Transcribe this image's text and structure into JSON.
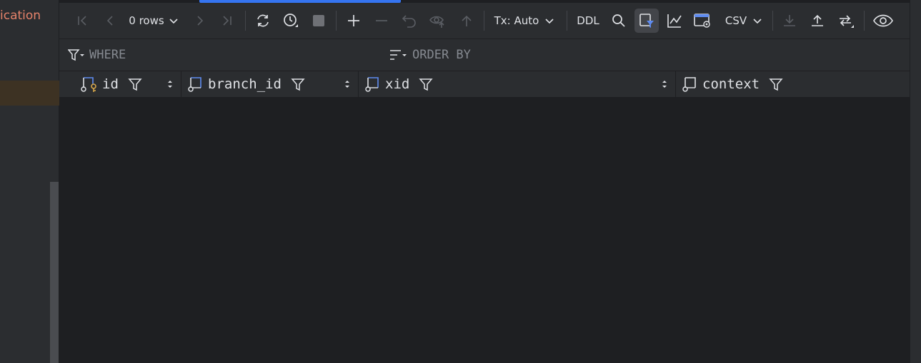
{
  "sidebar": {
    "truncated_label": "ication"
  },
  "toolbar": {
    "rows_label": "0 rows",
    "tx_label": "Tx: Auto",
    "ddl_label": "DDL",
    "export_format": "CSV",
    "icons": [
      "first-page-icon",
      "prev-page-icon",
      "next-page-icon",
      "last-page-icon",
      "refresh-icon",
      "history-icon",
      "stop-icon",
      "add-row-icon",
      "delete-row-icon",
      "revert-icon",
      "preview-icon",
      "submit-icon",
      "search-icon",
      "filter-icon",
      "chart-icon",
      "grid-view-icon",
      "download-icon",
      "upload-icon",
      "compare-icon",
      "view-icon"
    ]
  },
  "filters": {
    "where_label": "WHERE",
    "order_by_label": "ORDER BY"
  },
  "table": {
    "columns": [
      {
        "name": "id",
        "key": "primary"
      },
      {
        "name": "branch_id"
      },
      {
        "name": "xid"
      },
      {
        "name": "context"
      }
    ],
    "rows": []
  },
  "colors": {
    "accent": "#3574f0",
    "background": "#1e1f22",
    "panel": "#2b2d30",
    "key_icon": "#d6a64a",
    "column_icon": "#5e8bf0",
    "left_label": "#e5826a"
  }
}
